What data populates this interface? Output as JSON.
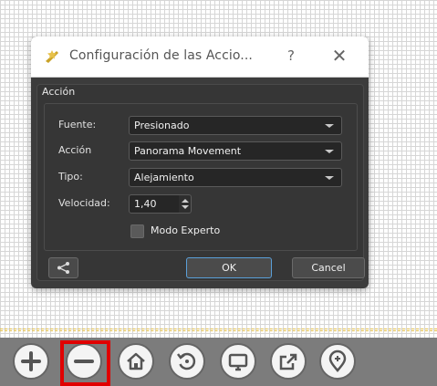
{
  "dialog": {
    "title": "Configuración de las Accio...",
    "help_label": "?",
    "close_label": "✕",
    "group_title": "Acción",
    "fields": {
      "fuente_label": "Fuente:",
      "fuente_value": "Presionado",
      "accion_label": "Acción",
      "accion_value": "Panorama Movement",
      "tipo_label": "Tipo:",
      "tipo_value": "Alejamiento",
      "velocidad_label": "Velocidad:",
      "velocidad_value": "1,40",
      "modo_experto_label": "Modo Experto",
      "modo_experto_checked": false
    },
    "buttons": {
      "ok": "OK",
      "cancel": "Cancel"
    }
  },
  "toolbar": {
    "items": [
      "zoom-in",
      "zoom-out",
      "home",
      "rotate",
      "screen",
      "external-link",
      "location"
    ],
    "highlighted_item": "zoom-out",
    "highlight_color": "#e00000"
  },
  "colors": {
    "dialog_bg": "#3c3c3c",
    "ok_border": "#5a9fd8"
  }
}
